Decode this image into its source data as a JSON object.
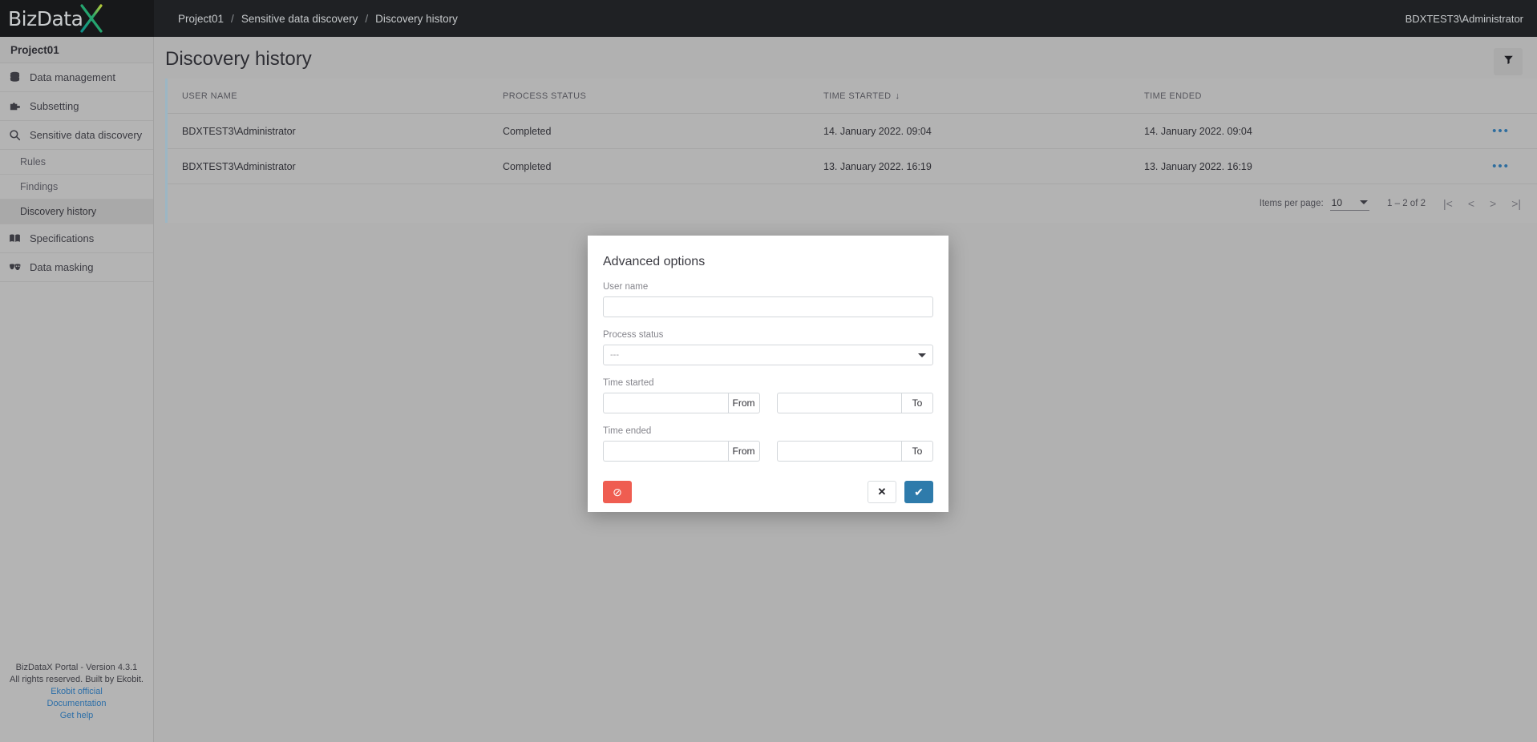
{
  "brand": {
    "logo_text": "BizData",
    "logo_mark": "X",
    "accent_teal": "#1fa39a",
    "accent_green": "#a6c83c"
  },
  "topbar": {
    "breadcrumb": [
      "Project01",
      "Sensitive data discovery",
      "Discovery history"
    ],
    "separator": "/",
    "user": "BDXTEST3\\Administrator"
  },
  "sidebar": {
    "project": "Project01",
    "items": [
      {
        "label": "Data management",
        "icon": "database-icon"
      },
      {
        "label": "Subsetting",
        "icon": "puzzle-icon"
      },
      {
        "label": "Sensitive data discovery",
        "icon": "magnifier-icon"
      }
    ],
    "subitems": [
      {
        "label": "Rules",
        "active": false
      },
      {
        "label": "Findings",
        "active": false
      },
      {
        "label": "Discovery history",
        "active": true
      }
    ],
    "items_after": [
      {
        "label": "Specifications",
        "icon": "book-icon"
      },
      {
        "label": "Data masking",
        "icon": "masks-icon"
      }
    ],
    "footer": {
      "version": "BizDataX Portal - Version 4.3.1",
      "rights": "All rights reserved. Built by Ekobit.",
      "links": [
        "Ekobit official",
        "Documentation",
        "Get help"
      ]
    }
  },
  "main": {
    "page_title": "Discovery history",
    "filter_icon": "funnel-icon",
    "table": {
      "columns": [
        "USER NAME",
        "PROCESS STATUS",
        "TIME STARTED",
        "TIME ENDED"
      ],
      "sort_column": "TIME STARTED",
      "sort_arrow": "↓",
      "rows": [
        {
          "user_name": "BDXTEST3\\Administrator",
          "process_status": "Completed",
          "time_started": "14. January 2022. 09:04",
          "time_ended": "14. January 2022. 09:04",
          "actions": "•••"
        },
        {
          "user_name": "BDXTEST3\\Administrator",
          "process_status": "Completed",
          "time_started": "13. January 2022. 16:19",
          "time_ended": "13. January 2022. 16:19",
          "actions": "•••"
        }
      ]
    },
    "paginator": {
      "items_per_page_label": "Items per page:",
      "items_per_page_value": "10",
      "range_label": "1 – 2 of 2",
      "first": "|<",
      "prev": "<",
      "next": ">",
      "last": ">|"
    }
  },
  "modal": {
    "title": "Advanced options",
    "user_name": {
      "label": "User name",
      "value": "",
      "placeholder": ""
    },
    "process_status": {
      "label": "Process status",
      "value": "---"
    },
    "time_started": {
      "label": "Time started",
      "from_value": "",
      "from_suffix": "From",
      "to_value": "",
      "to_suffix": "To"
    },
    "time_ended": {
      "label": "Time ended",
      "from_value": "",
      "from_suffix": "From",
      "to_value": "",
      "to_suffix": "To"
    },
    "buttons": {
      "clear": "⊘",
      "clear_name": "clear-filters-button",
      "cancel": "✕",
      "cancel_name": "cancel-button",
      "confirm": "✔",
      "confirm_name": "apply-button"
    }
  }
}
